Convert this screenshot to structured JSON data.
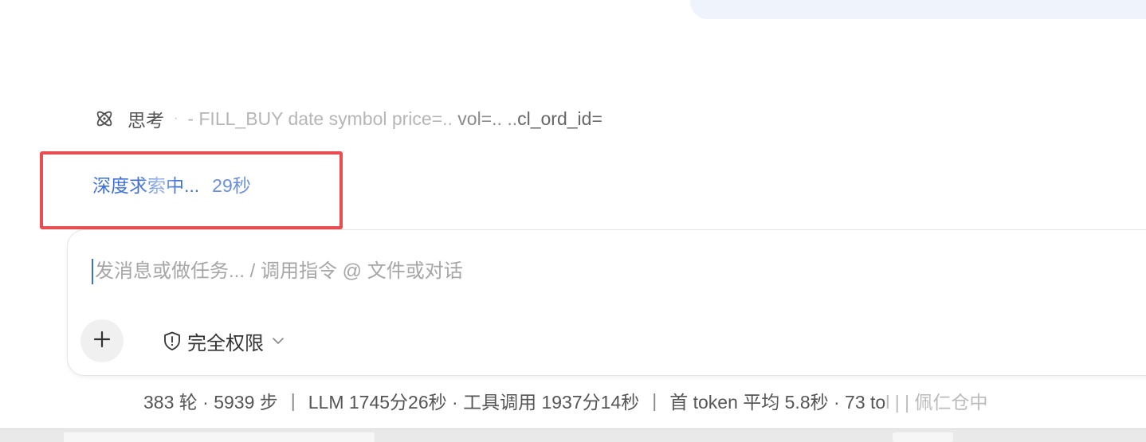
{
  "thinking": {
    "label": "思考",
    "separator": "·",
    "text_faded": "- FILL_BUY date symbol price=..",
    "text_mid": " vol=.. ..",
    "text_dark": "cl_ord_id="
  },
  "searching": {
    "label": "深度求索中...",
    "elapsed": "29秒"
  },
  "composer": {
    "placeholder": "发消息或做任务... / 调用指令 @ 文件或对话",
    "permission_label": "完全权限"
  },
  "status": {
    "rounds_steps": "383 轮 · 5939 步",
    "timing": "LLM 1745分26秒 · 工具调用 1937分14秒",
    "first_token": "首 token 平均 5.8秒 · 73 to",
    "truncated": "l | | 佩仁仓中"
  },
  "colors": {
    "accent": "#3d6fd6",
    "highlight_border": "#e84d4f",
    "top_bubble": "#eef3fc"
  }
}
